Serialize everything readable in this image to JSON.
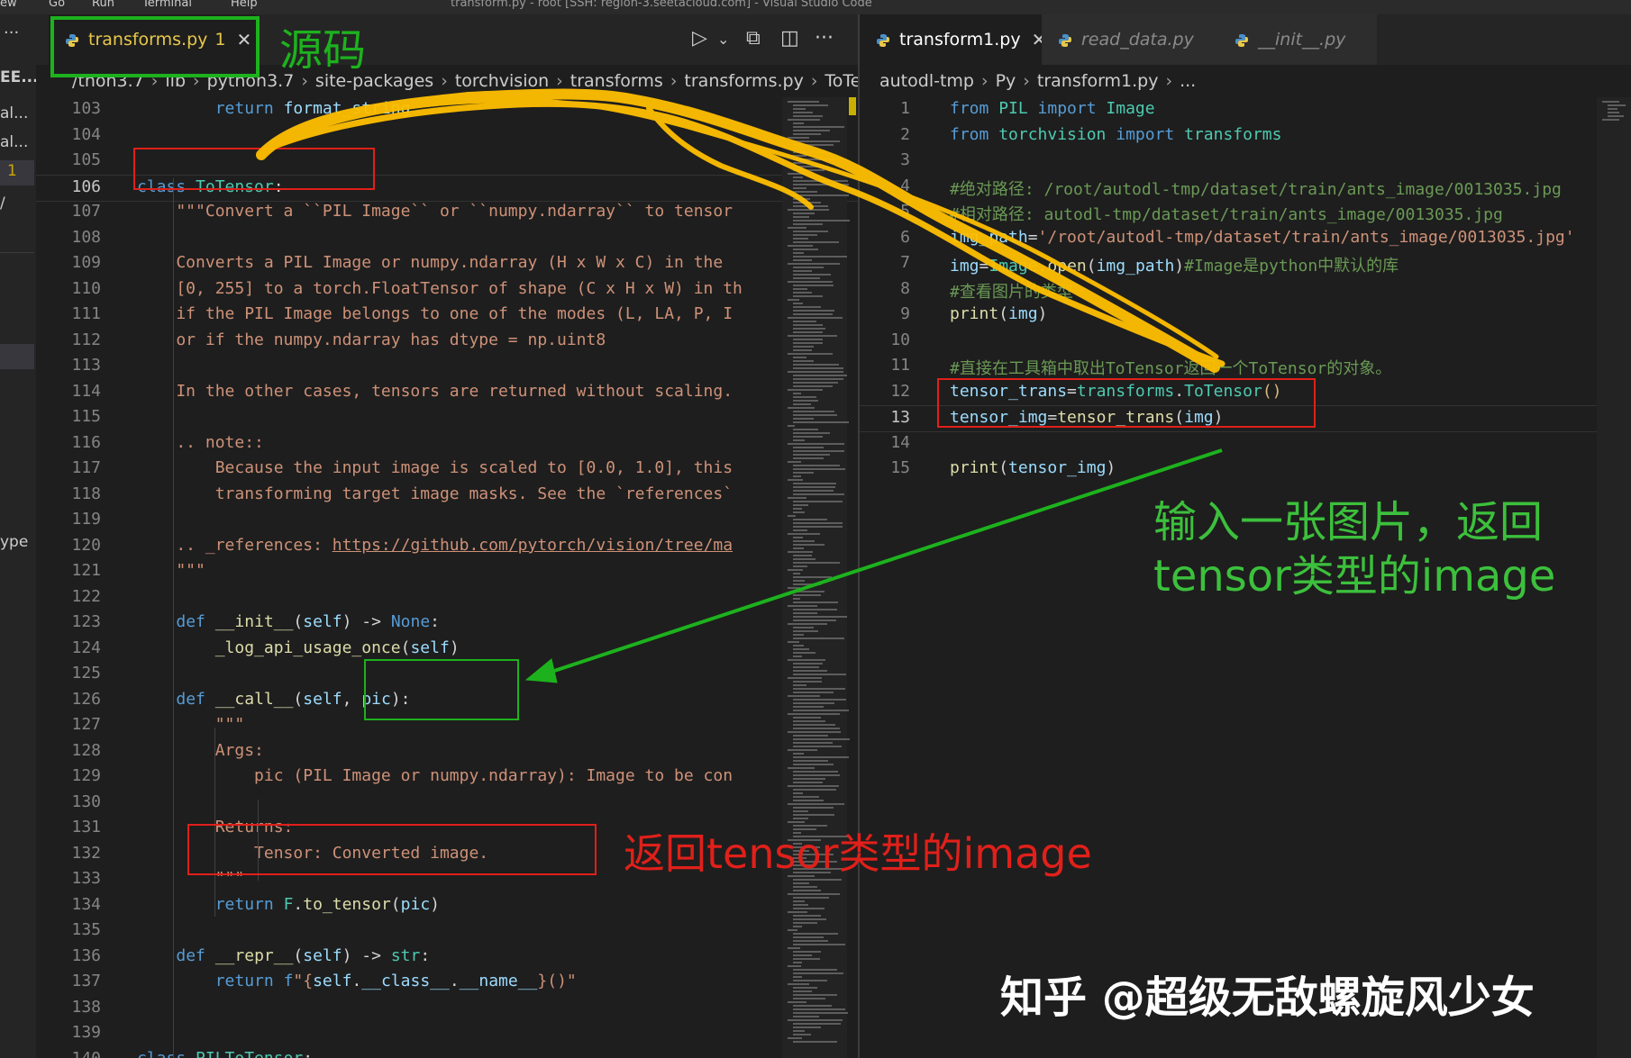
{
  "menubar": {
    "items": [
      "ew",
      "Go",
      "Run",
      "Terminal",
      "Help"
    ],
    "title": "transform.py - root [SSH: region-3.seetacloud.com] - Visual Studio Code"
  },
  "activity_fragments": [
    "EE...",
    "al...",
    "al...",
    "1",
    "/",
    "ype"
  ],
  "left": {
    "tabs": [
      {
        "label": "transforms.py",
        "badge": "1"
      }
    ],
    "toolbar": {
      "run": "▷",
      "run_menu": "⌄",
      "open_changes": "⧉",
      "split": "◫",
      "more": "···"
    },
    "breadcrumb": [
      "/thon3.7",
      "lib",
      "python3.7",
      "site-packages",
      "torchvision",
      "transforms",
      "transforms.py",
      "ToTensor"
    ],
    "current_line": 106,
    "lines": [
      {
        "n": 103,
        "t": [
          [
            "        ",
            ""
          ],
          [
            "return ",
            "k"
          ],
          [
            "format_string",
            "v"
          ]
        ]
      },
      {
        "n": 104,
        "t": []
      },
      {
        "n": 105,
        "t": []
      },
      {
        "n": 106,
        "t": [
          [
            "class ",
            "k"
          ],
          [
            "ToTensor",
            "c"
          ],
          [
            ":",
            ""
          ]
        ]
      },
      {
        "n": 107,
        "t": [
          [
            "    \"\"\"Convert a ``PIL Image`` or ``numpy.ndarray`` to tensor",
            "s"
          ]
        ]
      },
      {
        "n": 108,
        "t": []
      },
      {
        "n": 109,
        "t": [
          [
            "    Converts a PIL Image or numpy.ndarray (H x W x C) in the",
            "s"
          ]
        ]
      },
      {
        "n": 110,
        "t": [
          [
            "    [0, 255] to a torch.FloatTensor of shape (C x H x W) in th",
            "s"
          ]
        ]
      },
      {
        "n": 111,
        "t": [
          [
            "    if the PIL Image belongs to one of the modes (L, LA, P, I",
            "s"
          ]
        ]
      },
      {
        "n": 112,
        "t": [
          [
            "    or if the numpy.ndarray has dtype = np.uint8",
            "s"
          ]
        ]
      },
      {
        "n": 113,
        "t": []
      },
      {
        "n": 114,
        "t": [
          [
            "    In the other cases, tensors are returned without scaling.",
            "s"
          ]
        ]
      },
      {
        "n": 115,
        "t": []
      },
      {
        "n": 116,
        "t": [
          [
            "    .. note::",
            "s"
          ]
        ]
      },
      {
        "n": 117,
        "t": [
          [
            "        Because the input image is scaled to [0.0, 1.0], this",
            "s"
          ]
        ]
      },
      {
        "n": 118,
        "t": [
          [
            "        transforming target image masks. See the `references`",
            "s"
          ]
        ]
      },
      {
        "n": 119,
        "t": []
      },
      {
        "n": 120,
        "t": [
          [
            "    .. _references: ",
            "s"
          ],
          [
            "https://github.com/pytorch/vision/tree/ma",
            "u"
          ]
        ]
      },
      {
        "n": 121,
        "t": [
          [
            "    \"\"\"",
            "s"
          ]
        ]
      },
      {
        "n": 122,
        "t": []
      },
      {
        "n": 123,
        "t": [
          [
            "    ",
            ""
          ],
          [
            "def ",
            "k"
          ],
          [
            "__init__",
            "f"
          ],
          [
            "(",
            ""
          ],
          [
            "self",
            "v"
          ],
          [
            ") -> ",
            ""
          ],
          [
            "None",
            "k"
          ],
          [
            ":",
            ""
          ]
        ]
      },
      {
        "n": 124,
        "t": [
          [
            "        ",
            ""
          ],
          [
            "_log_api_usage_once",
            "f"
          ],
          [
            "(",
            ""
          ],
          [
            "self",
            "v"
          ],
          [
            ")",
            ""
          ]
        ]
      },
      {
        "n": 125,
        "t": []
      },
      {
        "n": 126,
        "t": [
          [
            "    ",
            ""
          ],
          [
            "def ",
            "k"
          ],
          [
            "__call__",
            "f"
          ],
          [
            "(",
            ""
          ],
          [
            "self",
            "v"
          ],
          [
            ", ",
            ""
          ],
          [
            "pic",
            "v"
          ],
          [
            "):",
            ""
          ]
        ]
      },
      {
        "n": 127,
        "t": [
          [
            "        \"\"\"",
            "s"
          ]
        ]
      },
      {
        "n": 128,
        "t": [
          [
            "        Args:",
            "s"
          ]
        ]
      },
      {
        "n": 129,
        "t": [
          [
            "            pic (PIL Image or numpy.ndarray): Image to be con",
            "s"
          ]
        ]
      },
      {
        "n": 130,
        "t": []
      },
      {
        "n": 131,
        "t": [
          [
            "        Returns:",
            "s"
          ]
        ]
      },
      {
        "n": 132,
        "t": [
          [
            "            Tensor: Converted image.",
            "s"
          ]
        ]
      },
      {
        "n": 133,
        "t": [
          [
            "        \"\"\"",
            "s"
          ]
        ]
      },
      {
        "n": 134,
        "t": [
          [
            "        ",
            ""
          ],
          [
            "return ",
            "k"
          ],
          [
            "F",
            "c"
          ],
          [
            ".",
            ""
          ],
          [
            "to_tensor",
            "f"
          ],
          [
            "(",
            ""
          ],
          [
            "pic",
            "v"
          ],
          [
            ")",
            ""
          ]
        ]
      },
      {
        "n": 135,
        "t": []
      },
      {
        "n": 136,
        "t": [
          [
            "    ",
            ""
          ],
          [
            "def ",
            "k"
          ],
          [
            "__repr__",
            "f"
          ],
          [
            "(",
            ""
          ],
          [
            "self",
            "v"
          ],
          [
            ") -> ",
            ""
          ],
          [
            "str",
            "c"
          ],
          [
            ":",
            ""
          ]
        ]
      },
      {
        "n": 137,
        "t": [
          [
            "        ",
            ""
          ],
          [
            "return ",
            "k"
          ],
          [
            "f",
            "k"
          ],
          [
            "\"{",
            "s"
          ],
          [
            "self",
            "v"
          ],
          [
            ".",
            ""
          ],
          [
            "__class__",
            "v"
          ],
          [
            ".",
            ""
          ],
          [
            "__name__",
            "v"
          ],
          [
            "}()\"",
            "s"
          ]
        ]
      },
      {
        "n": 138,
        "t": []
      },
      {
        "n": 139,
        "t": []
      },
      {
        "n": 140,
        "t": [
          [
            "class ",
            "k"
          ],
          [
            "PILToTensor",
            "c"
          ],
          [
            ":",
            ""
          ]
        ]
      }
    ]
  },
  "right": {
    "tabs": [
      {
        "label": "transform1.py",
        "active": true
      },
      {
        "label": "read_data.py"
      },
      {
        "label": "__init__.py"
      }
    ],
    "breadcrumb": [
      "autodl-tmp",
      "Py",
      "transform1.py",
      "..."
    ],
    "current_line": 13,
    "lines": [
      {
        "n": 1,
        "t": [
          [
            "from ",
            "k"
          ],
          [
            "PIL ",
            "c"
          ],
          [
            "import ",
            "k"
          ],
          [
            "Image",
            "c"
          ]
        ]
      },
      {
        "n": 2,
        "t": [
          [
            "from ",
            "k"
          ],
          [
            "torchvision ",
            "c"
          ],
          [
            "import ",
            "k"
          ],
          [
            "transforms",
            "c"
          ]
        ]
      },
      {
        "n": 3,
        "t": []
      },
      {
        "n": 4,
        "t": [
          [
            "#绝对路径: /root/autodl-tmp/dataset/train/ants_image/0013035.jpg",
            "cm"
          ]
        ]
      },
      {
        "n": 5,
        "t": [
          [
            "#相对路径: autodl-tmp/dataset/train/ants_image/0013035.jpg",
            "cm"
          ]
        ]
      },
      {
        "n": 6,
        "t": [
          [
            "img_path",
            "v"
          ],
          [
            "=",
            ""
          ],
          [
            "'/root/autodl-tmp/dataset/train/ants_image/0013035.jpg'",
            "s"
          ]
        ]
      },
      {
        "n": 7,
        "t": [
          [
            "img",
            "v"
          ],
          [
            "=",
            ""
          ],
          [
            "Image",
            "c"
          ],
          [
            ".",
            ""
          ],
          [
            "open",
            "f"
          ],
          [
            "(",
            ""
          ],
          [
            "img_path",
            "v"
          ],
          [
            ")",
            ""
          ],
          [
            "#Image是python中默认的库",
            "cm"
          ]
        ]
      },
      {
        "n": 8,
        "t": [
          [
            "#查看图片的类型",
            "cm"
          ]
        ]
      },
      {
        "n": 9,
        "t": [
          [
            "print",
            "f"
          ],
          [
            "(",
            ""
          ],
          [
            "img",
            "v"
          ],
          [
            ")",
            ""
          ]
        ]
      },
      {
        "n": 10,
        "t": []
      },
      {
        "n": 11,
        "t": [
          [
            "#直接在工具箱中取出ToTensor返回一个ToTensor的对象。",
            "cm"
          ]
        ]
      },
      {
        "n": 12,
        "t": [
          [
            "tensor_trans",
            "v"
          ],
          [
            "=",
            ""
          ],
          [
            "transforms",
            "c"
          ],
          [
            ".",
            ""
          ],
          [
            "ToTensor",
            "c"
          ],
          [
            "()",
            "y"
          ]
        ]
      },
      {
        "n": 13,
        "t": [
          [
            "tensor_img",
            "v"
          ],
          [
            "=",
            ""
          ],
          [
            "tensor_trans",
            "f"
          ],
          [
            "(",
            ""
          ],
          [
            "img",
            "v"
          ],
          [
            ")",
            ""
          ]
        ]
      },
      {
        "n": 14,
        "t": []
      },
      {
        "n": 15,
        "t": [
          [
            "print",
            "f"
          ],
          [
            "(",
            ""
          ],
          [
            "tensor_img",
            "v"
          ],
          [
            ")",
            ""
          ]
        ]
      }
    ]
  },
  "annotations": {
    "source_label": "源码",
    "right_note_line1": "输入一张图片，返回",
    "right_note_line2": "tensor类型的image",
    "returns_note": "返回tensor类型的image",
    "watermark": "知乎 @超级无敌螺旋风少女"
  },
  "colors": {
    "green": "#1db21d",
    "red": "#e0201a",
    "yellow": "#ffc107",
    "green_text": "#3cc03c"
  }
}
